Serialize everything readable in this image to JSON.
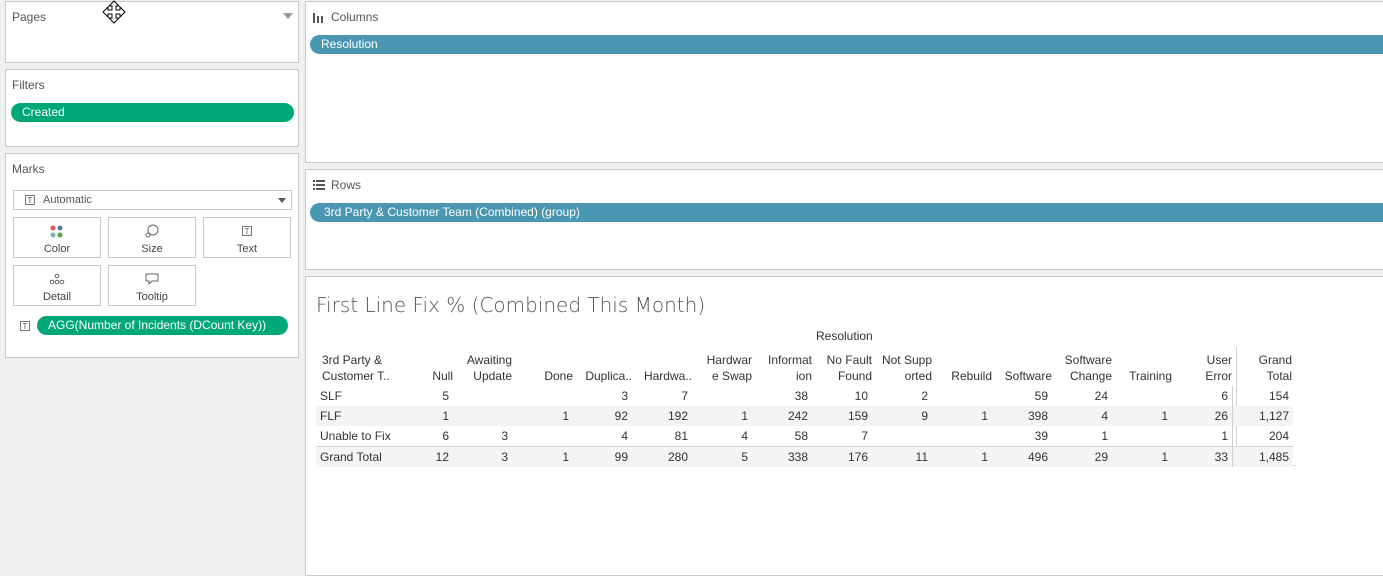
{
  "pages": {
    "title": "Pages"
  },
  "filters": {
    "title": "Filters",
    "pill": "Created"
  },
  "marks": {
    "title": "Marks",
    "type_select": "Automatic",
    "cards": {
      "color": "Color",
      "size": "Size",
      "text": "Text",
      "detail": "Detail",
      "tooltip": "Tooltip"
    },
    "text_field": "AGG(Number of Incidents (DCount Key))"
  },
  "shelves": {
    "columns_title": "Columns",
    "columns_pill": "Resolution",
    "rows_title": "Rows",
    "rows_pill": "3rd Party & Customer Team (Combined) (group)"
  },
  "view": {
    "title": "First Line Fix % (Combined This Month)",
    "column_group": "Resolution",
    "row_header": "3rd Party &\nCustomer T..",
    "columns": [
      "Null",
      "Awaiting\nUpdate",
      "Done",
      "Duplica..",
      "Hardwa..",
      "Hardwar\ne Swap",
      "Informat\nion",
      "No Fault\nFound",
      "Not Supp\norted",
      "Rebuild",
      "Software",
      "Software\nChange",
      "Training",
      "User\nError",
      "Grand\nTotal"
    ],
    "rows": [
      {
        "label": "SLF",
        "values": [
          "5",
          "",
          "",
          "3",
          "7",
          "",
          "38",
          "10",
          "2",
          "",
          "59",
          "24",
          "",
          "6",
          "154"
        ]
      },
      {
        "label": "FLF",
        "values": [
          "1",
          "",
          "1",
          "92",
          "192",
          "1",
          "242",
          "159",
          "9",
          "1",
          "398",
          "4",
          "1",
          "26",
          "1,127"
        ]
      },
      {
        "label": "Unable to Fix",
        "values": [
          "6",
          "3",
          "",
          "4",
          "81",
          "4",
          "58",
          "7",
          "",
          "",
          "39",
          "1",
          "",
          "1",
          "204"
        ]
      },
      {
        "label": "Grand Total",
        "values": [
          "12",
          "3",
          "1",
          "99",
          "280",
          "5",
          "338",
          "176",
          "11",
          "1",
          "496",
          "29",
          "1",
          "33",
          "1,485"
        ]
      }
    ]
  },
  "colors": {
    "green_pill": "#00a878",
    "blue_pill": "#4a97b4"
  }
}
